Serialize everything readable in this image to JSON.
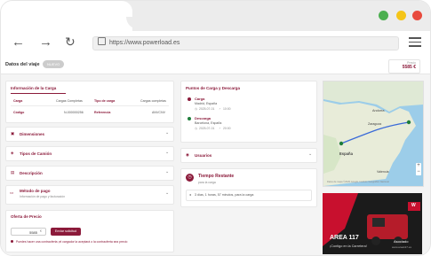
{
  "browser": {
    "url": "https://www.powerload.es"
  },
  "header": {
    "title": "Datos del viaje",
    "badge": "NUEVO",
    "price_label": "Precio",
    "price_value": "5585 €"
  },
  "load_info": {
    "title": "Información de la Carga",
    "rows": [
      {
        "l1": "Carga",
        "v1": "Cargas Completas",
        "l2": "Tipo de carga",
        "v2": "Cargas completas"
      },
      {
        "l1": "Código",
        "v1": "N-000000256",
        "l2": "Referencia",
        "v2": "ANVCNV"
      }
    ]
  },
  "accordions": [
    {
      "label": "Dimensiones",
      "icon": "ruler-icon",
      "glyph": "▣"
    },
    {
      "label": "Tipos de Camión",
      "icon": "truck-icon",
      "glyph": "◈"
    },
    {
      "label": "Descripción",
      "icon": "document-icon",
      "glyph": "▤"
    }
  ],
  "payment": {
    "title": "Método de pago",
    "subtitle": "Información de pago y facturación"
  },
  "offer": {
    "title": "Oferta de Precio",
    "amount": "5585",
    "button": "Enviar solicitud",
    "note": "Puedes hacer una contraoferta ¡el cargador la aceptará o la contraoferta sea precio"
  },
  "points": {
    "title": "Puntos de Carga y Descarga",
    "load": {
      "title": "Carga",
      "place": "Madrid, España",
      "date": "2025-07-01",
      "time": "10:00"
    },
    "unload": {
      "title": "Descarga",
      "place": "Barcelona, España",
      "date": "2025-07-01",
      "time": "20:00"
    }
  },
  "users": {
    "title": "Usuarios"
  },
  "remaining": {
    "title": "Tiempo Restante",
    "subtitle": "para la carga",
    "text": "3 días, 1 horas, 57 minutos, para la carga"
  },
  "map": {
    "labels": {
      "andorra": "Andorra",
      "espana": "España",
      "valencia": "Valencia",
      "zaragoza": "Zaragoza"
    },
    "caption": "Datos de mapa ©2025 Google, Instituto Geográfico Nacional",
    "controls": {
      "zoom_in": "+",
      "zoom_out": "−"
    }
  },
  "ad": {
    "brand": "AREA 117",
    "tag": "Asociado",
    "caption": "¡Contigo en la Carretera!",
    "site": "www.area117.es"
  }
}
